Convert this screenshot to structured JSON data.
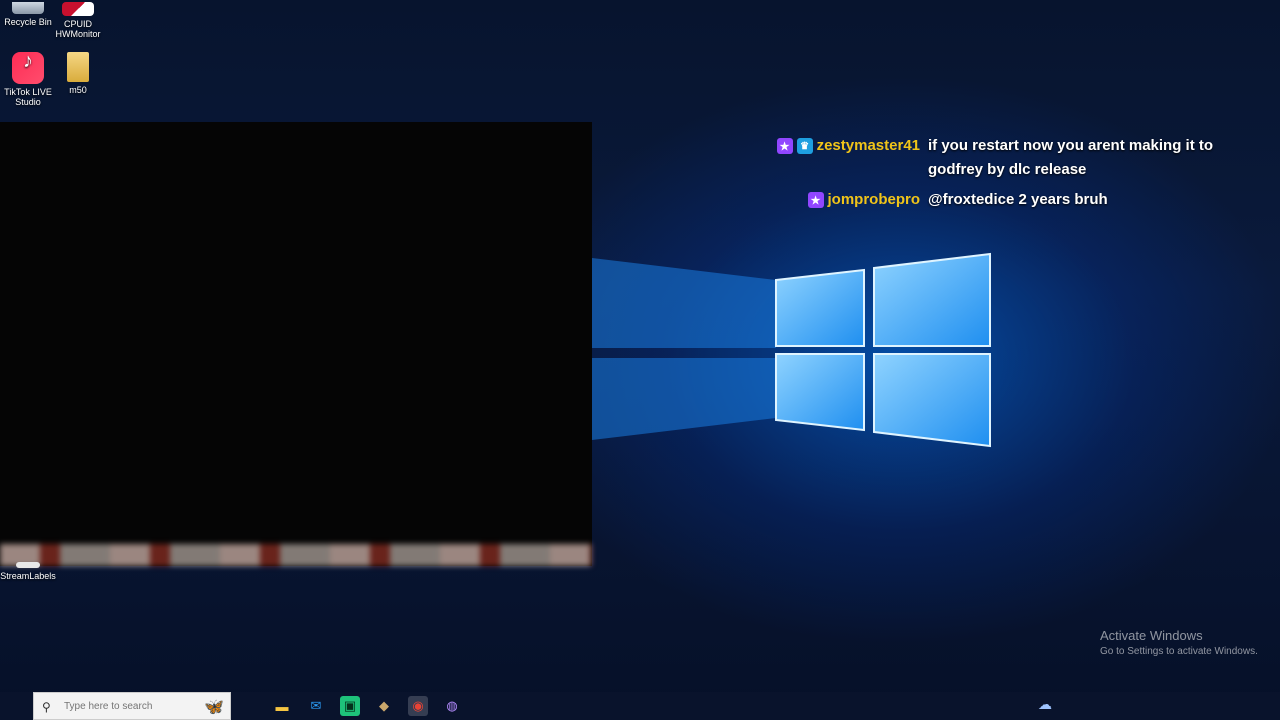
{
  "desktop_icons": {
    "recycle_bin": "Recycle Bin",
    "cpuid": "CPUID HWMonitor",
    "tiktok": "TikTok LIVE Studio",
    "m50": "m50",
    "streamlabels": "StreamLabels"
  },
  "chat": {
    "messages": [
      {
        "user": "zestymaster41",
        "text": "if you restart now you arent making it to godfrey by dlc release",
        "badges": [
          "star-icon",
          "crown-icon"
        ]
      },
      {
        "user": "jomprobepro",
        "text": "@froxtedice 2 years bruh",
        "badges": [
          "star-icon"
        ]
      }
    ]
  },
  "watermark": {
    "title": "Activate Windows",
    "subtitle": "Go to Settings to activate Windows."
  },
  "taskbar": {
    "search_placeholder": "Type here to search",
    "apps": [
      "file-explorer-icon",
      "mail-icon",
      "app-icon",
      "photos-icon",
      "chrome-icon",
      "streaming-app-icon"
    ]
  },
  "colors": {
    "username": "#f0c419",
    "badge_star": "#9146ff",
    "badge_crown": "#1e9fe0"
  }
}
